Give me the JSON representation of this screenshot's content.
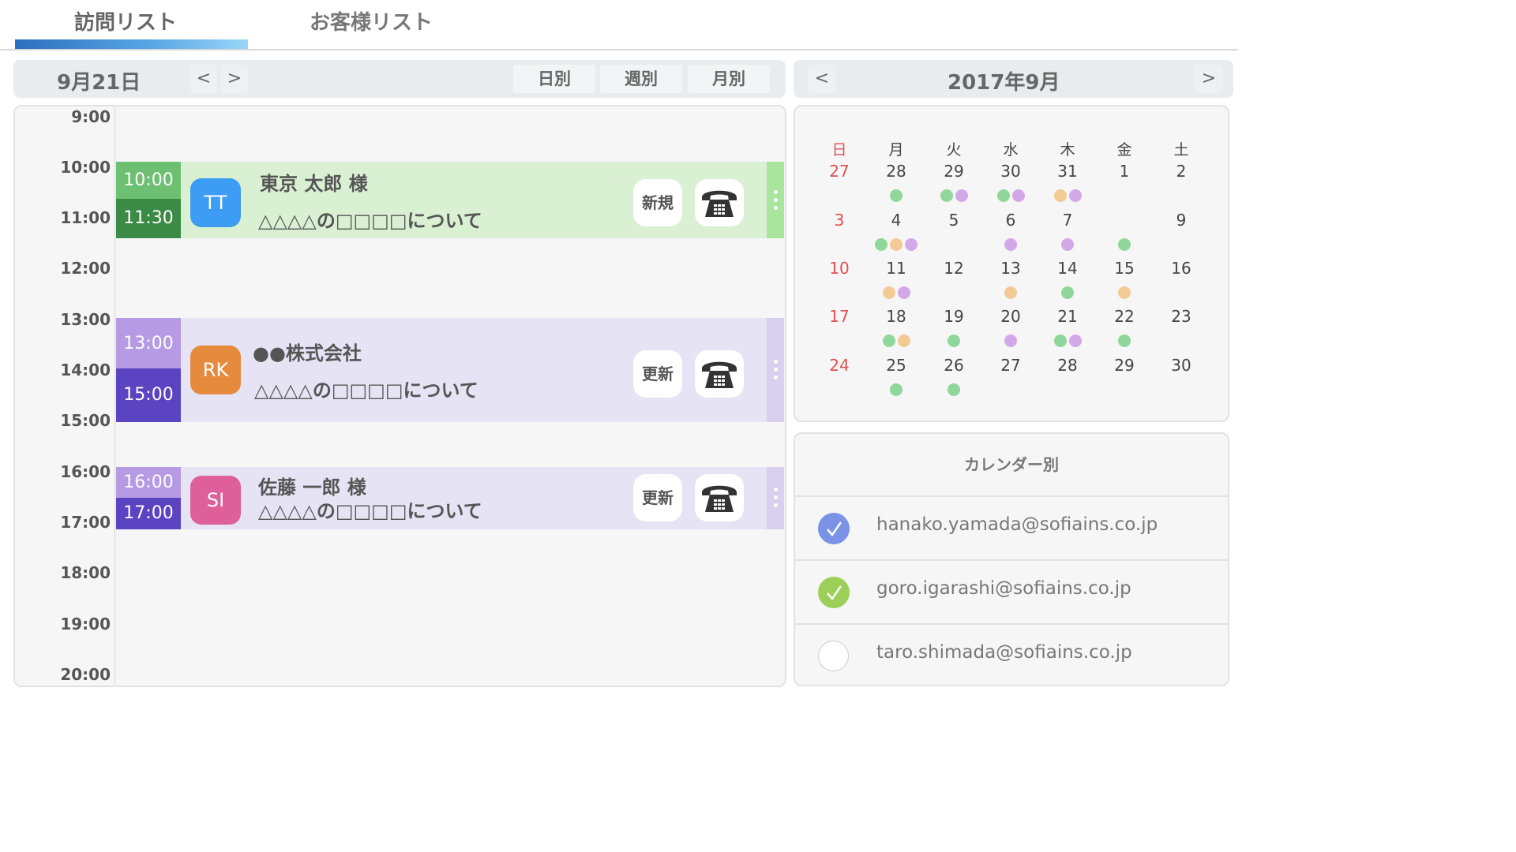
{
  "tabs": [
    {
      "label": "訪問リスト",
      "active": true
    },
    {
      "label": "お客様リスト",
      "active": false
    }
  ],
  "schedule_bar": {
    "date": "9月21日",
    "prev": "<",
    "next": ">",
    "views": [
      "日別",
      "週別",
      "月別"
    ]
  },
  "hours": [
    "9:00",
    "10:00",
    "11:00",
    "12:00",
    "13:00",
    "14:00",
    "15:00",
    "16:00",
    "17:00",
    "18:00",
    "19:00",
    "20:00"
  ],
  "events": [
    {
      "start": "10:00",
      "end": "11:30",
      "initials": "TT",
      "title": "東京 太郎 様",
      "subtitle": "△△△△の□□□□について",
      "tag": "新規",
      "color": "#d9f0d2",
      "start_color": "#6dbf71",
      "end_color": "#3b8a45",
      "avatar_color": "#3d9cf3",
      "edge_color": "#a9e59d"
    },
    {
      "start": "13:00",
      "end": "15:00",
      "initials": "RK",
      "title": "●●株式会社",
      "subtitle": "△△△△の□□□□について",
      "tag": "更新",
      "color": "#e6e3f4",
      "start_color": "#b69ae4",
      "end_color": "#5b44c1",
      "avatar_color": "#e68a3e",
      "edge_color": "#d9d0ef"
    },
    {
      "start": "16:00",
      "end": "17:00",
      "initials": "SI",
      "title": "佐藤 一郎 様",
      "subtitle": "△△△△の□□□□について",
      "tag": "更新",
      "color": "#e6e3f4",
      "start_color": "#b69ae4",
      "end_color": "#5b44c1",
      "avatar_color": "#df5f9b",
      "edge_color": "#d9d0ef"
    }
  ],
  "calendar": {
    "prev": "<",
    "next": ">",
    "title": "2017年9月",
    "weekdays": [
      "日",
      "月",
      "火",
      "水",
      "木",
      "金",
      "土"
    ],
    "weeks": [
      [
        {
          "d": "27",
          "dots": []
        },
        {
          "d": "28",
          "dots": [
            "g"
          ]
        },
        {
          "d": "29",
          "dots": [
            "g",
            "p"
          ]
        },
        {
          "d": "30",
          "dots": [
            "g",
            "p"
          ]
        },
        {
          "d": "31",
          "dots": [
            "o",
            "p"
          ]
        },
        {
          "d": "1",
          "dots": []
        },
        {
          "d": "2",
          "dots": []
        }
      ],
      [
        {
          "d": "3",
          "dots": []
        },
        {
          "d": "4",
          "dots": [
            "g",
            "o",
            "p"
          ]
        },
        {
          "d": "5",
          "dots": []
        },
        {
          "d": "6",
          "dots": [
            "p"
          ]
        },
        {
          "d": "7",
          "dots": [
            "p"
          ]
        },
        {
          "d": "",
          "dots": [
            "g"
          ]
        },
        {
          "d": "9",
          "dots": []
        }
      ],
      [
        {
          "d": "10",
          "dots": []
        },
        {
          "d": "11",
          "dots": [
            "o",
            "p"
          ]
        },
        {
          "d": "12",
          "dots": []
        },
        {
          "d": "13",
          "dots": [
            "o"
          ]
        },
        {
          "d": "14",
          "dots": [
            "g"
          ]
        },
        {
          "d": "15",
          "dots": [
            "o"
          ]
        },
        {
          "d": "16",
          "dots": []
        }
      ],
      [
        {
          "d": "17",
          "dots": []
        },
        {
          "d": "18",
          "dots": [
            "g",
            "o"
          ]
        },
        {
          "d": "19",
          "dots": [
            "g"
          ]
        },
        {
          "d": "20",
          "dots": [
            "p"
          ]
        },
        {
          "d": "21",
          "dots": [
            "g",
            "p"
          ]
        },
        {
          "d": "22",
          "dots": [
            "g"
          ]
        },
        {
          "d": "23",
          "dots": []
        }
      ],
      [
        {
          "d": "24",
          "dots": []
        },
        {
          "d": "25",
          "dots": [
            "g"
          ]
        },
        {
          "d": "26",
          "dots": [
            "g"
          ]
        },
        {
          "d": "27",
          "dots": []
        },
        {
          "d": "28",
          "dots": []
        },
        {
          "d": "29",
          "dots": []
        },
        {
          "d": "30",
          "dots": []
        }
      ]
    ],
    "dot_colors": {
      "g": "#8fd79a",
      "o": "#f2cb94",
      "p": "#d3a8e8"
    }
  },
  "calendar_list": {
    "heading": "カレンダー別",
    "items": [
      {
        "email": "hanako.yamada@sofiains.co.jp",
        "checked": true,
        "color": "#7b93e6"
      },
      {
        "email": "goro.igarashi@sofiains.co.jp",
        "checked": true,
        "color": "#9ccf58"
      },
      {
        "email": "taro.shimada@sofiains.co.jp",
        "checked": false,
        "color": "#ffffff"
      }
    ]
  }
}
